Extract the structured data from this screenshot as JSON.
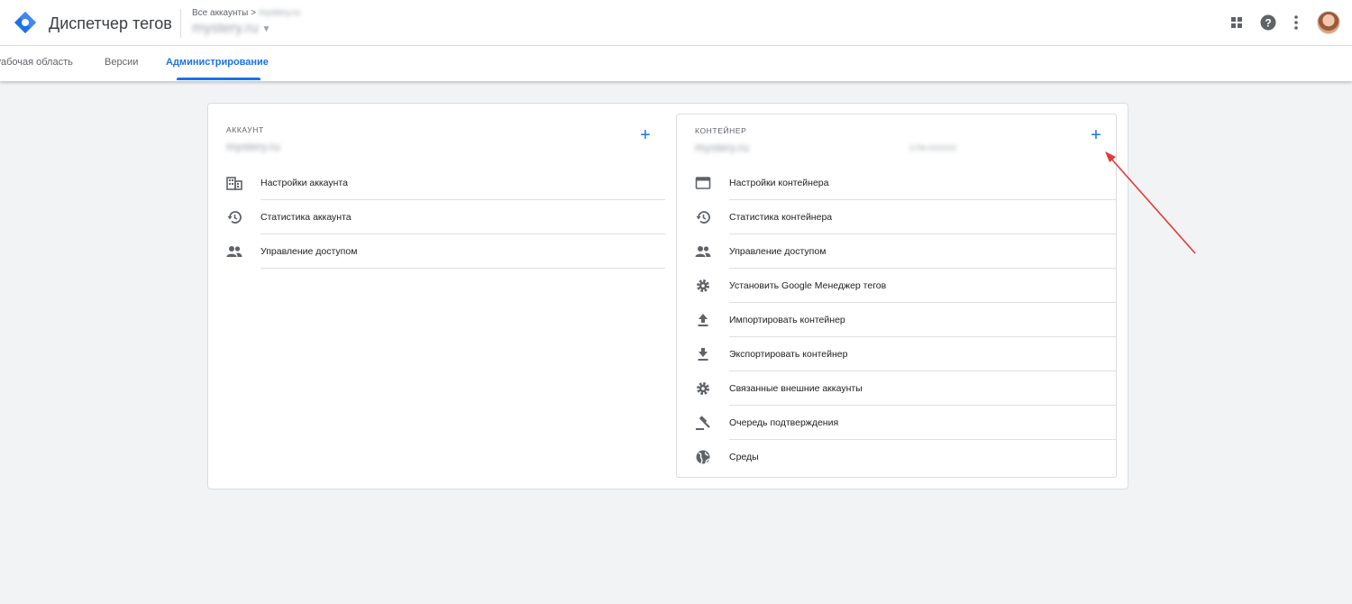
{
  "header": {
    "app_title": "Диспетчер тегов",
    "breadcrumb_root": "Все аккаунты",
    "breadcrumb_sep": ">",
    "breadcrumb_account": "mystery.ru",
    "account_select": "mystery.ru",
    "icons": [
      "apps-icon",
      "help-icon",
      "more-vert-icon",
      "avatar"
    ]
  },
  "tabs": [
    {
      "label": "Рабочая область"
    },
    {
      "label": "Версии"
    },
    {
      "label": "Администрирование",
      "active": true
    }
  ],
  "account": {
    "label": "АККАУНТ",
    "name": "mystery.ru",
    "add_label": "+",
    "items": [
      {
        "label": "Настройки аккаунта",
        "icon": "building-icon"
      },
      {
        "label": "Статистика аккаунта",
        "icon": "history-icon"
      },
      {
        "label": "Управление доступом",
        "icon": "people-icon"
      }
    ]
  },
  "container": {
    "label": "КОНТЕЙНЕР",
    "name": "mystery.ru",
    "container_id": "GTM-XXXXXX",
    "add_label": "+",
    "items": [
      {
        "label": "Настройки контейнера",
        "icon": "web-icon"
      },
      {
        "label": "Статистика контейнера",
        "icon": "history-icon"
      },
      {
        "label": "Управление доступом",
        "icon": "people-icon"
      },
      {
        "label": "Установить Google Менеджер тегов",
        "icon": "gear-icon"
      },
      {
        "label": "Импортировать контейнер",
        "icon": "upload-icon"
      },
      {
        "label": "Экспортировать контейнер",
        "icon": "download-icon"
      },
      {
        "label": "Связанные внешние аккаунты",
        "icon": "gear-icon"
      },
      {
        "label": "Очередь подтверждения",
        "icon": "gavel-icon"
      },
      {
        "label": "Среды",
        "icon": "globe-icon"
      }
    ]
  },
  "colors": {
    "accent": "#1a73e8",
    "annotation_arrow": "#e53935",
    "background": "#f1f3f4"
  }
}
